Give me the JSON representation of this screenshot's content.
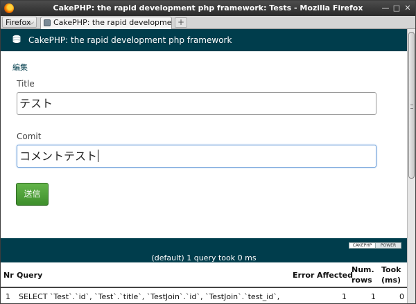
{
  "window": {
    "title": "CakePHP: the rapid development php framework: Tests - Mozilla Firefox"
  },
  "tabbar": {
    "firefox_menu": "Firefox",
    "tab_label": "CakePHP: the rapid development p...",
    "new_tab": "+"
  },
  "page": {
    "header_title": "CakePHP: the rapid development php framework",
    "breadcrumb": "編集",
    "form": {
      "title_label": "Title",
      "title_value": "テスト",
      "comment_label": "Comit",
      "comment_value": "コメントテスト",
      "submit_label": "送信"
    },
    "footer": {
      "power_left": "CAKEPHP",
      "power_right": "POWER",
      "summary": "(default) 1 query took 0 ms"
    },
    "sql": {
      "headers": {
        "nr": "Nr",
        "query": "Query",
        "error": "Error",
        "affected": "Affected",
        "num_rows": "Num.\nrows",
        "took": "Took\n(ms)"
      },
      "row": {
        "nr": "1",
        "query": "SELECT `Test`.`id`, `Test`.`title`, `TestJoin`.`id`, `TestJoin`.`test_id`,",
        "affected": "1",
        "num_rows": "1",
        "took": "0"
      }
    }
  }
}
